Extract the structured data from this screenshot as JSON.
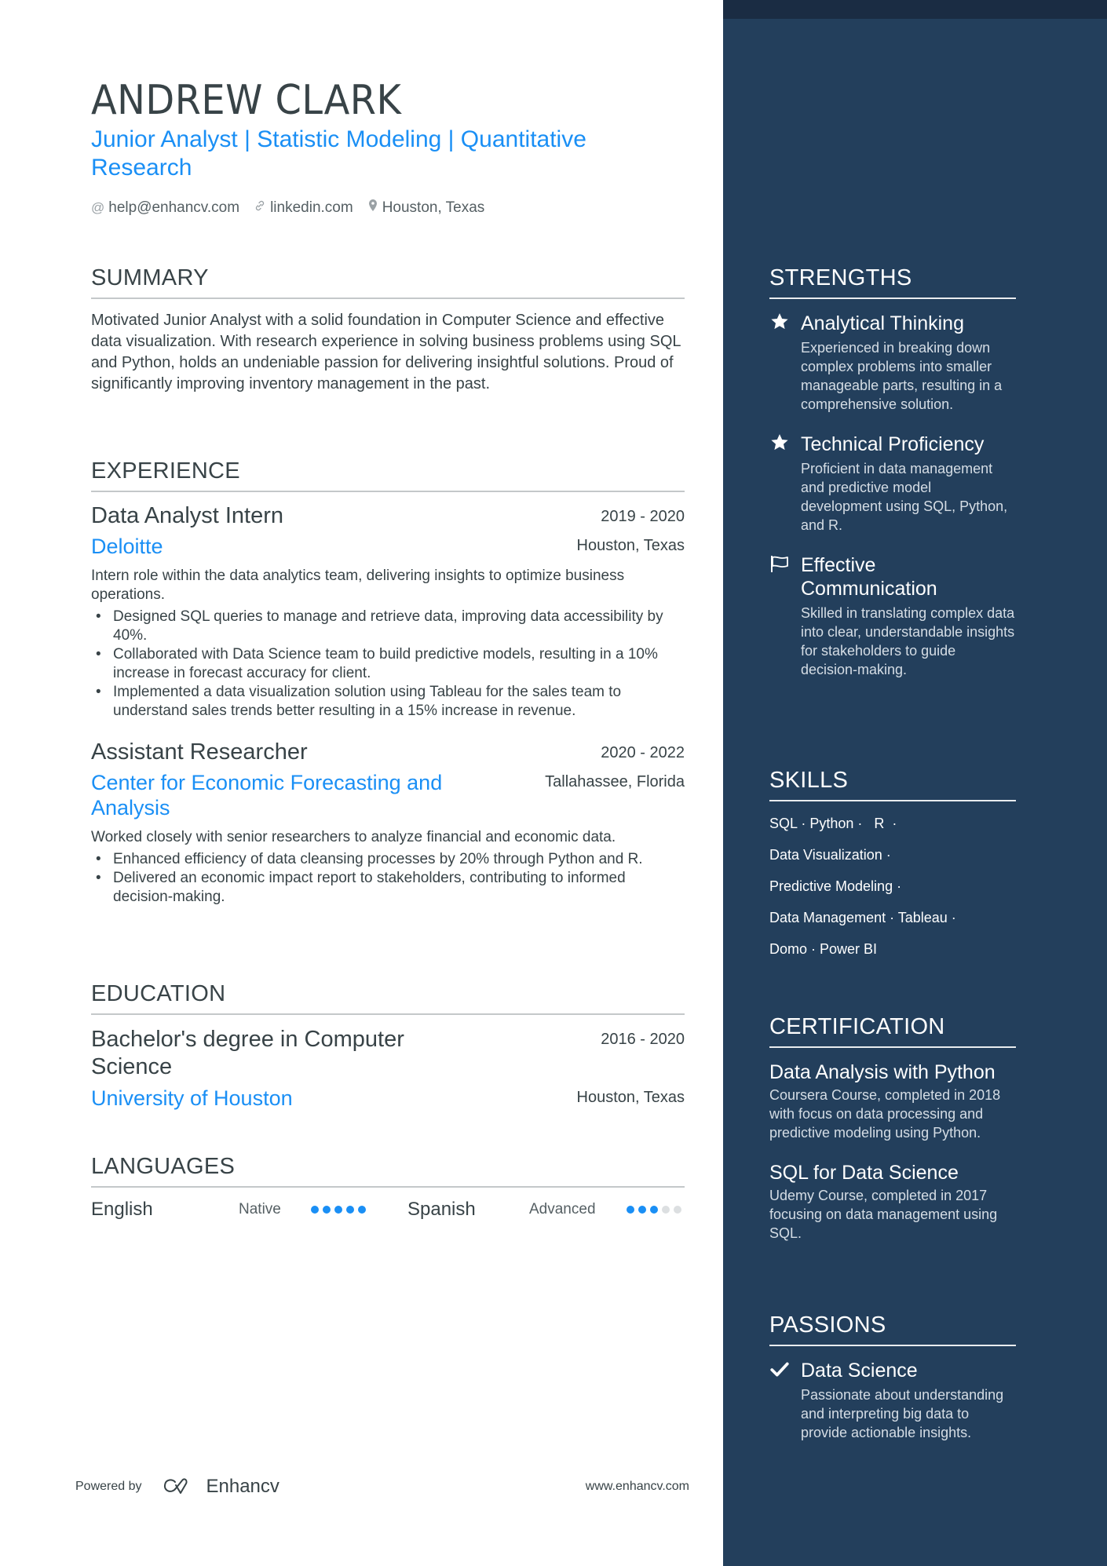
{
  "header": {
    "name": "ANDREW CLARK",
    "title": "Junior Analyst | Statistic Modeling | Quantitative Research",
    "contacts": [
      {
        "icon": "at-icon",
        "text": "help@enhancv.com"
      },
      {
        "icon": "link-icon",
        "text": "linkedin.com"
      },
      {
        "icon": "location-pin-icon",
        "text": "Houston, Texas"
      }
    ]
  },
  "summary": {
    "heading": "SUMMARY",
    "text": "Motivated Junior Analyst with a solid foundation in Computer Science and effective data visualization. With research experience in solving business problems using SQL and Python, holds an undeniable passion for delivering insightful solutions. Proud of significantly improving inventory management in the past."
  },
  "experience": {
    "heading": "EXPERIENCE",
    "jobs": [
      {
        "title": "Data Analyst Intern",
        "dates": "2019 - 2020",
        "company": "Deloitte",
        "location": "Houston, Texas",
        "description": "Intern role within the data analytics team, delivering insights to optimize business operations.",
        "bullets": [
          "Designed SQL queries to manage and retrieve data, improving data accessibility by 40%.",
          "Collaborated with Data Science team to build predictive models, resulting in a 10% increase in forecast accuracy for client.",
          "Implemented a data visualization solution using Tableau for the sales team to understand sales trends better resulting in a 15% increase in revenue."
        ]
      },
      {
        "title": "Assistant Researcher",
        "dates": "2020 - 2022",
        "company": "Center for Economic Forecasting and Analysis",
        "location": "Tallahassee, Florida",
        "description": "Worked closely with senior researchers to analyze financial and economic data.",
        "bullets": [
          "Enhanced efficiency of data cleansing processes by 20% through Python and R.",
          "Delivered an economic impact report to stakeholders, contributing to informed decision-making."
        ]
      }
    ]
  },
  "education": {
    "heading": "EDUCATION",
    "items": [
      {
        "degree": "Bachelor's degree in Computer Science",
        "dates": "2016 - 2020",
        "school": "University of Houston",
        "location": "Houston, Texas"
      }
    ]
  },
  "languages": {
    "heading": "LANGUAGES",
    "items": [
      {
        "name": "English",
        "level": "Native",
        "proficiency": 5,
        "max": 5
      },
      {
        "name": "Spanish",
        "level": "Advanced",
        "proficiency": 3,
        "max": 5
      }
    ]
  },
  "strengths": {
    "heading": "STRENGTHS",
    "items": [
      {
        "icon": "star-icon",
        "title": "Analytical Thinking",
        "description": "Experienced in breaking down complex problems into smaller manageable parts, resulting in a comprehensive solution."
      },
      {
        "icon": "star-icon",
        "title": "Technical Proficiency",
        "description": "Proficient in data management and predictive model development using SQL, Python, and R."
      },
      {
        "icon": "flag-icon",
        "title": "Effective Communication",
        "description": "Skilled in translating complex data into clear, understandable insights for stakeholders to guide decision-making."
      }
    ]
  },
  "skills": {
    "heading": "SKILLS",
    "lines": [
      "SQL · Python ·   R  ·",
      "Data Visualization ·",
      "Predictive Modeling ·",
      "Data Management · Tableau ·",
      "Domo · Power BI"
    ]
  },
  "certification": {
    "heading": "CERTIFICATION",
    "items": [
      {
        "title": "Data Analysis with Python",
        "description": "Coursera Course, completed in 2018 with focus on data processing and predictive modeling using Python."
      },
      {
        "title": "SQL for Data Science",
        "description": "Udemy Course, completed in 2017 focusing on data management using SQL."
      }
    ]
  },
  "passions": {
    "heading": "PASSIONS",
    "items": [
      {
        "icon": "checkmark-icon",
        "title": "Data Science",
        "description": "Passionate about understanding and interpreting big data to provide actionable insights."
      }
    ]
  },
  "footer": {
    "powered_by": "Powered by",
    "brand": "Enhancv",
    "website": "www.enhancv.com"
  },
  "colors": {
    "accent": "#1a8ff5",
    "sidebar": "#233f5c",
    "sidebar_band": "#1a2c43",
    "text": "#384347"
  }
}
